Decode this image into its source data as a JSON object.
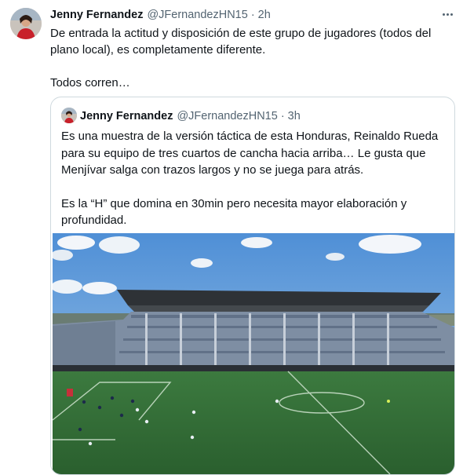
{
  "tweet": {
    "author_name": "Jenny Fernandez",
    "handle": "@JFernandezHN15",
    "separator": "·",
    "time": "2h",
    "text_lines": [
      "De entrada la actitud y disposición de este grupo de jugadores (todos del plano local), es completamente diferente."
    ],
    "text_line2": "Todos corren…"
  },
  "quoted_tweet": {
    "author_name": "Jenny Fernandez",
    "handle": "@JFernandezHN15",
    "separator": "·",
    "time": "3h",
    "paragraph1": "Es una muestra de la versión táctica de esta Honduras, Reinaldo Rueda para su equipo de tres cuartos de cancha hacia arriba… Le gusta que Menjívar salga con trazos largos y no se juega para atrás.",
    "paragraph2": "Es la “H” que domina en 30min pero necesita mayor elaboración y profundidad."
  },
  "icons": {
    "more": "more-horizontal-icon"
  },
  "colors": {
    "text_primary": "#0f1419",
    "text_secondary": "#536471",
    "border": "#cfd9de",
    "sky": "#6fa8e0",
    "pitch": "#2f6b35"
  }
}
